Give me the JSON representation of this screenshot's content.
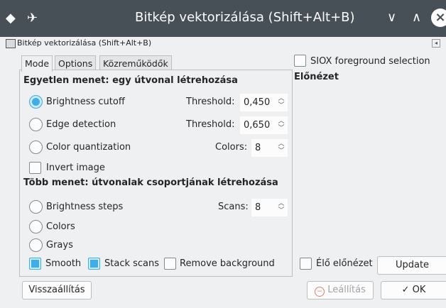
{
  "window": {
    "title": "Bitkép vektorizálása (Shift+Alt+B)",
    "pin_icon": "pin-icon",
    "app_icon": "app-menu-icon",
    "minimize_glyph": "∨",
    "maximize_glyph": "∧",
    "close_glyph": "×"
  },
  "dock": {
    "title": "Bitkép vektorizálása (Shift+Alt+B)"
  },
  "tabs": [
    "Mode",
    "Options",
    "Közreműködők"
  ],
  "single_scan": {
    "heading": "Egyetlen menet: egy útvonal létrehozása",
    "options": [
      {
        "label": "Brightness cutoff",
        "field_label": "Threshold:",
        "value": "0,450",
        "selected": true
      },
      {
        "label": "Edge detection",
        "field_label": "Threshold:",
        "value": "0,650",
        "selected": false
      },
      {
        "label": "Color quantization",
        "field_label": "Colors:",
        "value": "8",
        "selected": false
      }
    ],
    "invert_label": "Invert image",
    "invert_checked": false
  },
  "multi_scan": {
    "heading": "Több menet: útvonalak csoportjának létrehozása",
    "options": [
      {
        "label": "Brightness steps",
        "field_label": "Scans:",
        "value": "8",
        "selected": false
      },
      {
        "label": "Colors",
        "selected": false
      },
      {
        "label": "Grays",
        "selected": false
      }
    ]
  },
  "bottom_checks": {
    "smooth": "Smooth",
    "smooth_checked": true,
    "stack": "Stack scans",
    "stack_checked": true,
    "remove_bg": "Remove background",
    "remove_bg_checked": false
  },
  "preview": {
    "siox_label": "SIOX foreground selection",
    "siox_checked": false,
    "heading": "Előnézet",
    "live_label": "Élő előnézet",
    "live_checked": false,
    "update_label": "Update"
  },
  "buttons": {
    "reset": "Visszaállítás",
    "stop": "Leállítás",
    "ok": "OK"
  }
}
